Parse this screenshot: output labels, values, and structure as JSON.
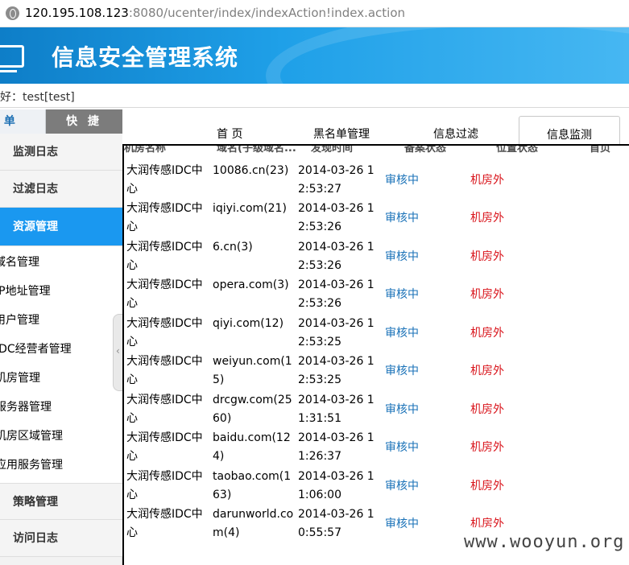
{
  "browser": {
    "url_host": "120.195.108.123",
    "url_rest": ":8080/ucenter/index/indexAction!index.action"
  },
  "header": {
    "title": "信息安全管理系统",
    "greeting": "好：test[test]"
  },
  "side_tabs": {
    "menu": "菜 单",
    "quick": "快 捷"
  },
  "sidebar": {
    "categories": [
      {
        "label": "监测日志"
      },
      {
        "label": "过滤日志"
      },
      {
        "label": "资源管理"
      },
      {
        "label": "策略管理"
      },
      {
        "label": "访问日志"
      }
    ],
    "sub_items": [
      {
        "label": "域名管理"
      },
      {
        "label": "IP地址管理"
      },
      {
        "label": "用户管理"
      },
      {
        "label": "IDC经营者管理"
      },
      {
        "label": "机房管理"
      },
      {
        "label": "服务器管理"
      },
      {
        "label": "机房区域管理"
      },
      {
        "label": "应用服务管理"
      }
    ]
  },
  "main_tabs": [
    {
      "label": "首 页"
    },
    {
      "label": "黑名单管理"
    },
    {
      "label": "信息过滤"
    },
    {
      "label": "信息监测"
    }
  ],
  "table": {
    "headers": [
      "机房名称",
      "域名(子级域名...",
      "发现时间",
      "备案状态",
      "位置状态",
      "首页"
    ],
    "rows": [
      {
        "room": "大润传感IDC中心",
        "domain": "10086.cn(23)",
        "time": "2014-03-26 12:53:27",
        "status": "审核中",
        "location": "机房外"
      },
      {
        "room": "大润传感IDC中心",
        "domain": "iqiyi.com(21)",
        "time": "2014-03-26 12:53:26",
        "status": "审核中",
        "location": "机房外"
      },
      {
        "room": "大润传感IDC中心",
        "domain": "6.cn(3)",
        "time": "2014-03-26 12:53:26",
        "status": "审核中",
        "location": "机房外"
      },
      {
        "room": "大润传感IDC中心",
        "domain": "opera.com(3)",
        "time": "2014-03-26 12:53:26",
        "status": "审核中",
        "location": "机房外"
      },
      {
        "room": "大润传感IDC中心",
        "domain": "qiyi.com(12)",
        "time": "2014-03-26 12:53:25",
        "status": "审核中",
        "location": "机房外"
      },
      {
        "room": "大润传感IDC中心",
        "domain": "weiyun.com(15)",
        "time": "2014-03-26 12:53:25",
        "status": "审核中",
        "location": "机房外"
      },
      {
        "room": "大润传感IDC中心",
        "domain": "drcgw.com(2560)",
        "time": "2014-03-26 11:31:51",
        "status": "审核中",
        "location": "机房外"
      },
      {
        "room": "大润传感IDC中心",
        "domain": "baidu.com(124)",
        "time": "2014-03-26 11:26:37",
        "status": "审核中",
        "location": "机房外"
      },
      {
        "room": "大润传感IDC中心",
        "domain": "taobao.com(163)",
        "time": "2014-03-26 11:06:00",
        "status": "审核中",
        "location": "机房外"
      },
      {
        "room": "大润传感IDC中心",
        "domain": "darunworld.com(4)",
        "time": "2014-03-26 10:55:57",
        "status": "审核中",
        "location": "机房外"
      }
    ]
  },
  "watermark": "www.wooyun.org",
  "colors": {
    "accent": "#1a98f0",
    "status_text": "#1a72b8",
    "location_text": "#d9141b"
  }
}
